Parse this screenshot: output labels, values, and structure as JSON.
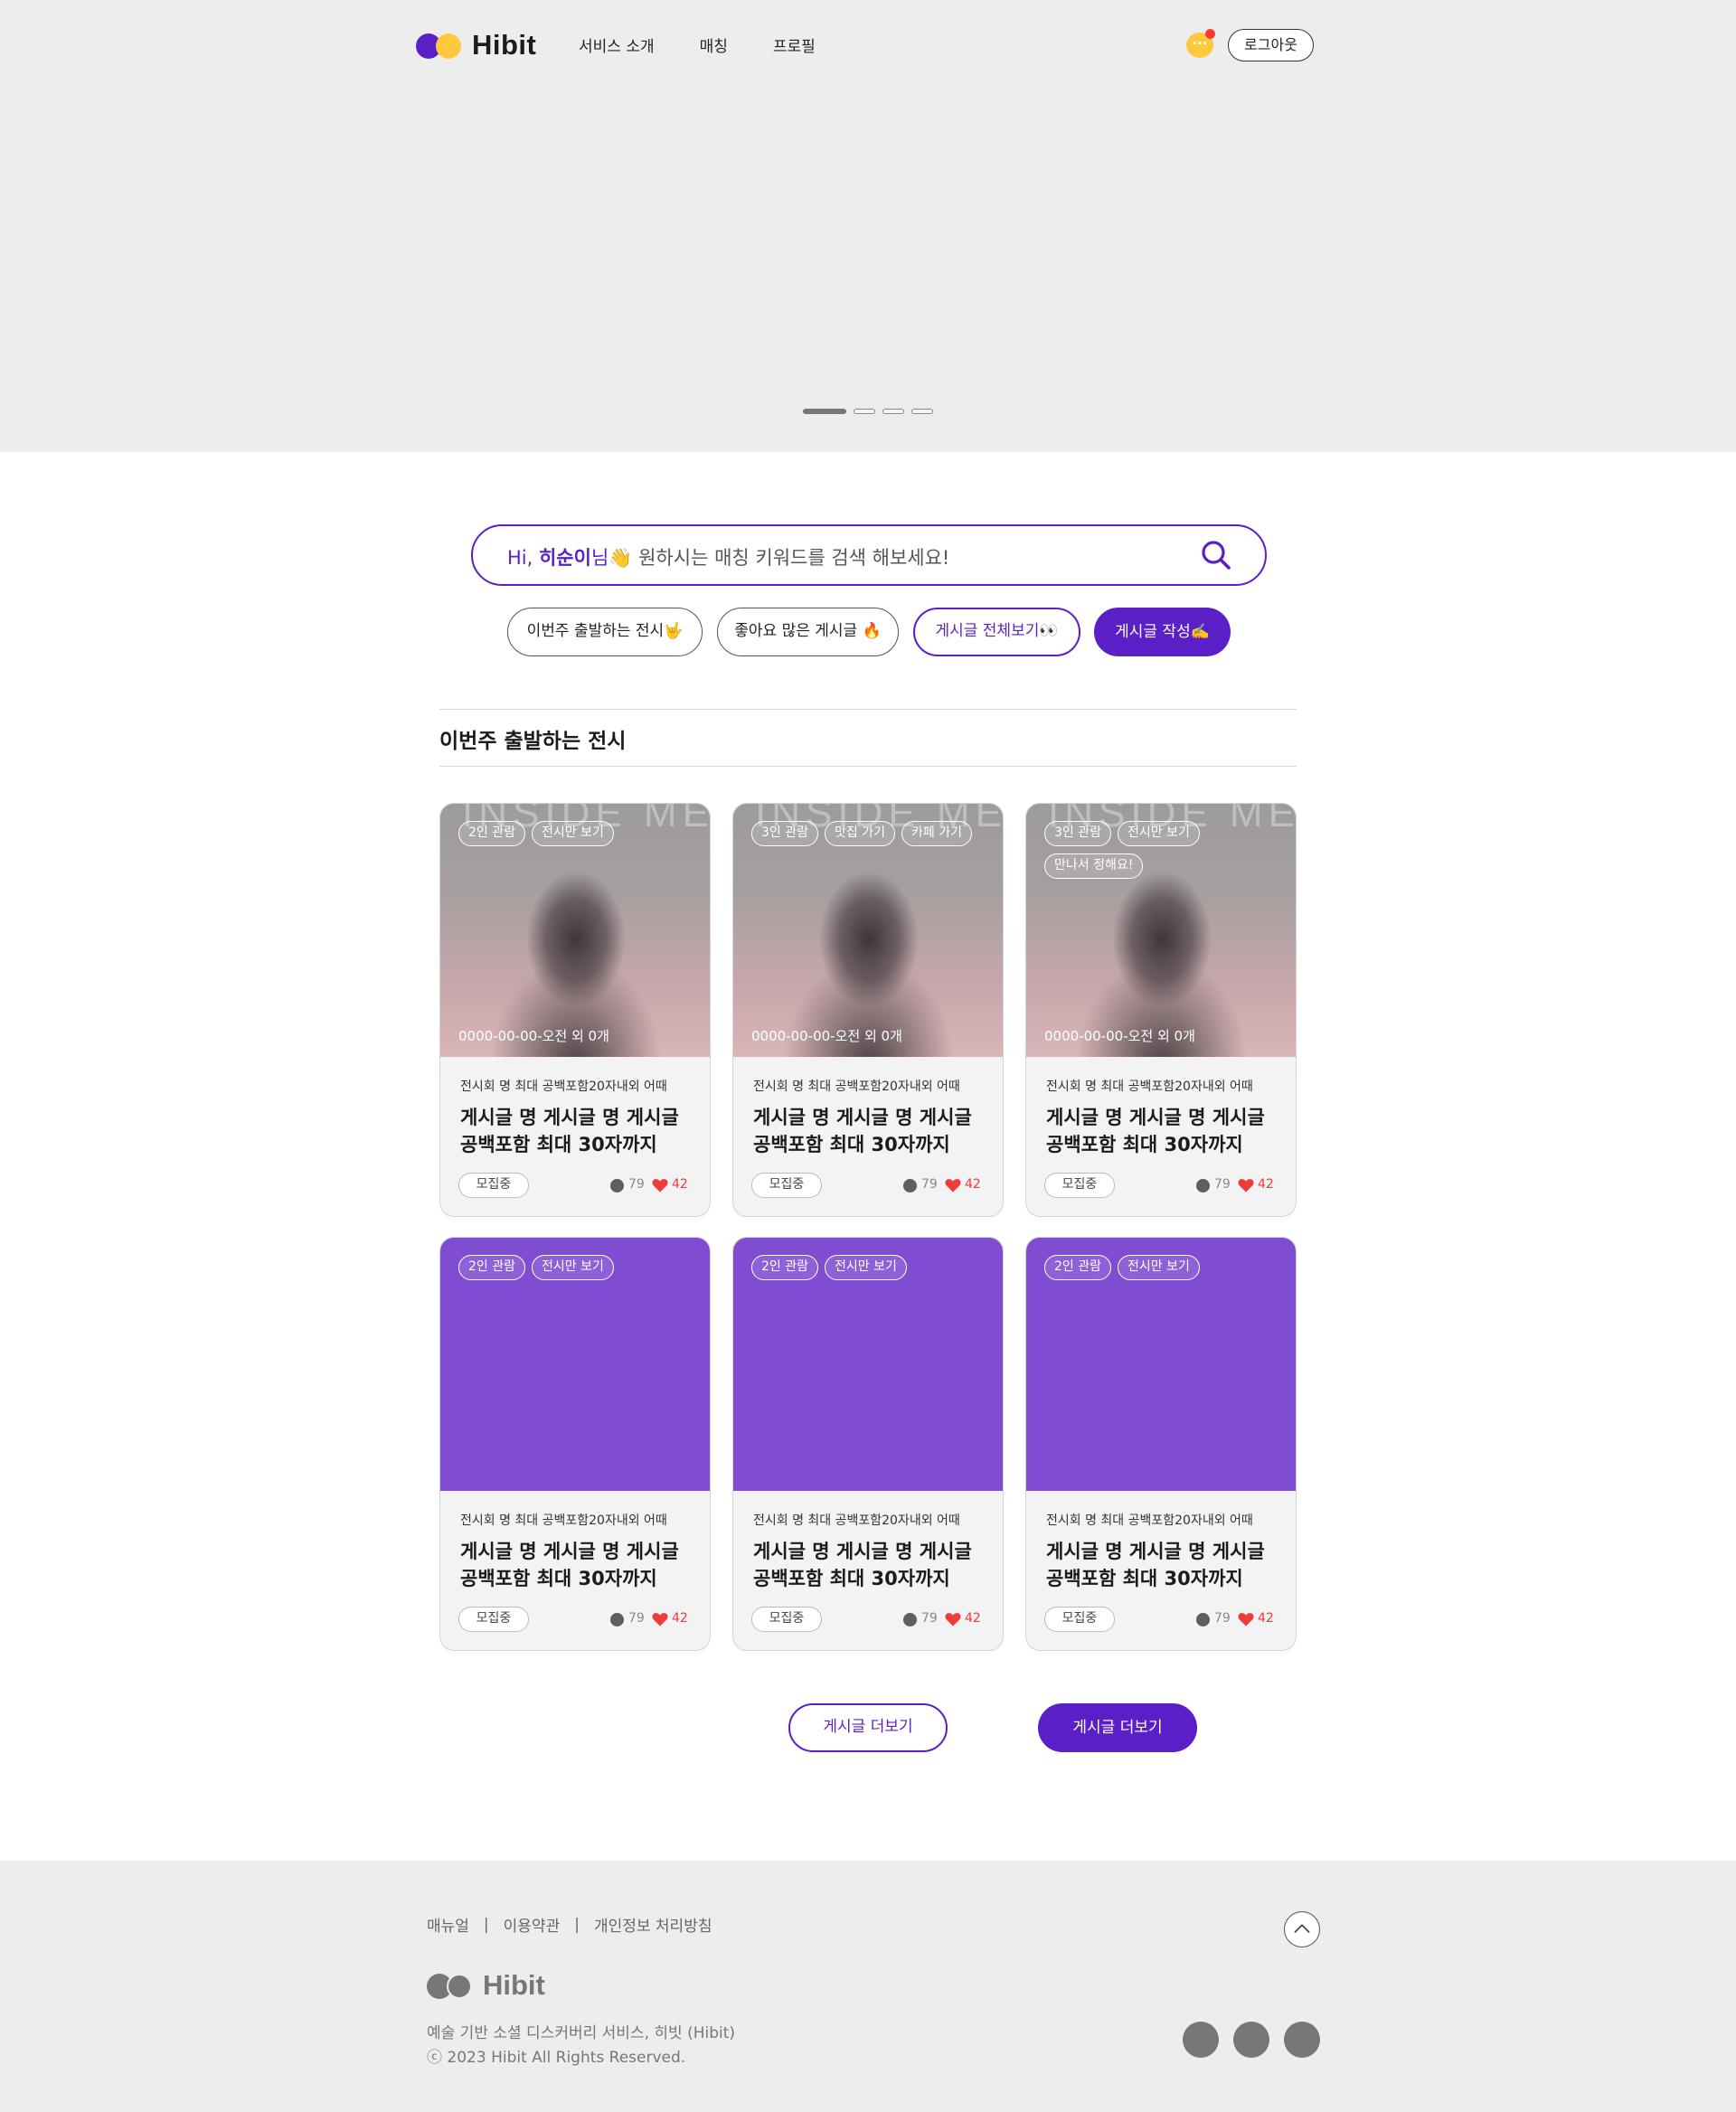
{
  "header": {
    "logo_text": "Hibit",
    "menu": [
      "서비스 소개",
      "매칭",
      "프로필"
    ],
    "chat_icon_glyph": "···",
    "logout_label": "로그아웃"
  },
  "hero": {
    "slide_count": 4,
    "active_slide": 1
  },
  "search": {
    "greeting": "Hi, ",
    "user_name": "히순이",
    "honorific": "님",
    "emoji": "👋",
    "prompt": " 원하시는 매칭 키워드를 검색 해보세요!"
  },
  "pills": [
    {
      "label": "이번주 출발하는 전시🤟"
    },
    {
      "label": "좋아요 많은 게시글 🔥"
    },
    {
      "label": "게시글 전체보기👀"
    },
    {
      "label": "게시글 작성✍️"
    }
  ],
  "section": {
    "title": "이번주 출발하는 전시"
  },
  "cards": [
    {
      "media": "photo",
      "ghost_text": "INSIDE ME",
      "tags": [
        "2인 관람",
        "전시만 보기"
      ],
      "date": "0000-00-00-오전 외 0개",
      "subtitle": "전시회 명 최대 공백포함20자내외 어때",
      "title": "게시글 명 게시글 명 게시글 공백포함 최대 30자까지",
      "status": "모집중",
      "views": "79",
      "likes": "42"
    },
    {
      "media": "photo",
      "ghost_text": "INSIDE ME",
      "tags": [
        "3인 관람",
        "맛집 가기",
        "카페 가기"
      ],
      "date": "0000-00-00-오전 외 0개",
      "subtitle": "전시회 명 최대 공백포함20자내외 어때",
      "title": "게시글 명 게시글 명 게시글 공백포함 최대 30자까지",
      "status": "모집중",
      "views": "79",
      "likes": "42"
    },
    {
      "media": "photo",
      "ghost_text": "INSIDE ME",
      "tags": [
        "3인 관람",
        "전시만 보기",
        "만나서 정해요!"
      ],
      "date": "0000-00-00-오전 외 0개",
      "subtitle": "전시회 명 최대 공백포함20자내외 어때",
      "title": "게시글 명 게시글 명 게시글 공백포함 최대 30자까지",
      "status": "모집중",
      "views": "79",
      "likes": "42"
    },
    {
      "media": "purple",
      "ghost_text": "",
      "tags": [
        "2인 관람",
        "전시만 보기"
      ],
      "date": "",
      "subtitle": "전시회 명 최대 공백포함20자내외 어때",
      "title": "게시글 명 게시글 명 게시글 공백포함 최대 30자까지",
      "status": "모집중",
      "views": "79",
      "likes": "42"
    },
    {
      "media": "purple",
      "ghost_text": "",
      "tags": [
        "2인 관람",
        "전시만 보기"
      ],
      "date": "",
      "subtitle": "전시회 명 최대 공백포함20자내외 어때",
      "title": "게시글 명 게시글 명 게시글 공백포함 최대 30자까지",
      "status": "모집중",
      "views": "79",
      "likes": "42"
    },
    {
      "media": "purple",
      "ghost_text": "",
      "tags": [
        "2인 관람",
        "전시만 보기"
      ],
      "date": "",
      "subtitle": "전시회 명 최대 공백포함20자내외 어때",
      "title": "게시글 명 게시글 명 게시글 공백포함 최대 30자까지",
      "status": "모집중",
      "views": "79",
      "likes": "42"
    }
  ],
  "more_buttons": [
    "게시글 더보기",
    "게시글 더보기"
  ],
  "footer": {
    "links": [
      "매뉴얼",
      "이용약관",
      "개인정보 처리방침"
    ],
    "separator": "|",
    "logo_text": "Hibit",
    "description": "예술 기반 소셜 디스커버리 서비스, 히빗 (Hibit)",
    "copyright": "ⓒ 2023 Hibit All Rights Reserved.",
    "social_icons": [
      "social-icon-1",
      "social-icon-2",
      "social-icon-3"
    ]
  },
  "colors": {
    "brand": "#5b1fc7",
    "accent_yellow": "#ffc83d",
    "like_red": "#ee3b3b",
    "card_purple": "#7f4cd2"
  }
}
